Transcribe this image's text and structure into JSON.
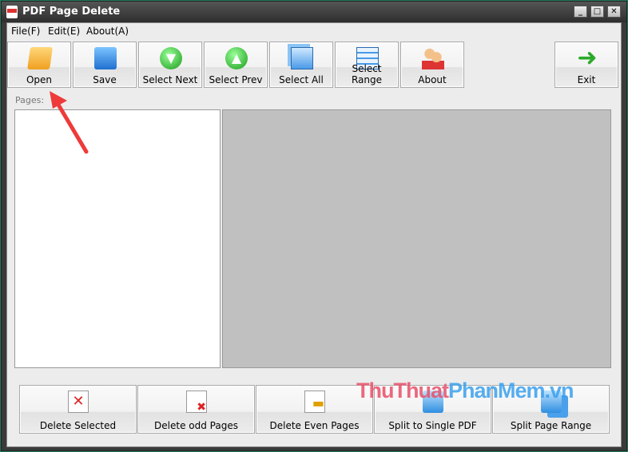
{
  "window": {
    "title": "PDF Page Delete",
    "min": "_",
    "max": "□",
    "close": "✕"
  },
  "menu": [
    "File(F)",
    "Edit(E)",
    "About(A)"
  ],
  "toolbar": [
    {
      "label": "Open",
      "icon": "folder-icon"
    },
    {
      "label": "Save",
      "icon": "floppy-icon"
    },
    {
      "label": "Select Next",
      "icon": "down-arrow-icon"
    },
    {
      "label": "Select Prev",
      "icon": "up-arrow-icon"
    },
    {
      "label": "Select All",
      "icon": "pages-icon"
    },
    {
      "label": "Select Range",
      "icon": "range-icon"
    },
    {
      "label": "About",
      "icon": "users-icon"
    },
    {
      "label": "Exit",
      "icon": "exit-arrow-icon"
    }
  ],
  "pages_label": "Pages:",
  "bottom": [
    {
      "label": "Delete Selected"
    },
    {
      "label": "Delete odd Pages"
    },
    {
      "label": "Delete Even Pages"
    },
    {
      "label": "Split to Single PDF"
    },
    {
      "label": "Split Page Range"
    }
  ],
  "watermark": {
    "a": "ThuThuat",
    "b": "PhanMem",
    "c": ".vn"
  }
}
